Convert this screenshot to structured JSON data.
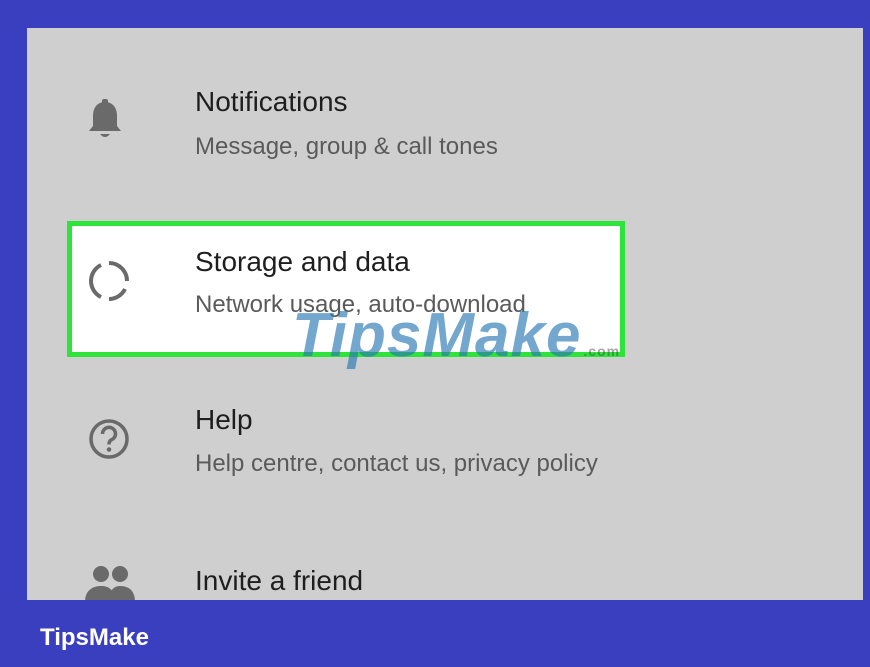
{
  "settings": {
    "items": [
      {
        "title": "Notifications",
        "subtitle": "Message, group & call tones",
        "icon": "bell-icon"
      },
      {
        "title": "Storage and data",
        "subtitle": "Network usage, auto-download",
        "icon": "storage-data-icon",
        "highlighted": true
      },
      {
        "title": "Help",
        "subtitle": "Help centre, contact us, privacy policy",
        "icon": "help-circle-icon"
      },
      {
        "title": "Invite a friend",
        "icon": "people-icon"
      }
    ]
  },
  "watermark": {
    "text": "TipsMake",
    "suffix": ".com"
  },
  "footer": {
    "brand": "TipsMake"
  },
  "colors": {
    "frame": "#3a3fbf",
    "panel": "#cfcfcf",
    "highlight_border": "#2ee33a"
  }
}
